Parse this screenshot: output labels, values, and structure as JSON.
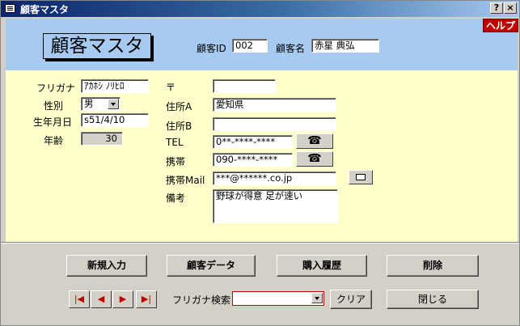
{
  "window": {
    "title": "顧客マスタ",
    "help_label": "?",
    "close_label": "×"
  },
  "header": {
    "help_button": "ヘルプ",
    "form_title": "顧客マスタ",
    "customer_id_label": "顧客ID",
    "customer_id_value": "002",
    "customer_name_label": "顧客名",
    "customer_name_value": "赤星 典弘"
  },
  "form": {
    "furigana_label": "フリガナ",
    "furigana_value": "ｱｶﾎｼ ﾉﾘﾋﾛ",
    "gender_label": "性別",
    "gender_value": "男",
    "birthdate_label": "生年月日",
    "birthdate_value": "s51/4/10",
    "age_label": "年齢",
    "age_value": "30",
    "postal_label": "〒",
    "postal_value": "",
    "address_a_label": "住所A",
    "address_a_value": "愛知県",
    "address_b_label": "住所B",
    "address_b_value": "",
    "tel_label": "TEL",
    "tel_value": "0**-****-****",
    "mobile_label": "携帯",
    "mobile_value": "090-****-****",
    "mobile_mail_label": "携帯Mail",
    "mobile_mail_value": "***@******.co.jp",
    "notes_label": "備考",
    "notes_value": "野球が得意 足が速い"
  },
  "buttons": {
    "new_entry": "新規入力",
    "customer_data": "顧客データ",
    "purchase_history": "購入履歴",
    "delete": "削除",
    "furigana_search_label": "フリガナ検索",
    "clear": "クリア",
    "close": "閉じる"
  },
  "icons": {
    "phone": "☎",
    "nav_first": "|◀",
    "nav_prev": "◀",
    "nav_next": "▶",
    "nav_last": "▶|"
  },
  "colors": {
    "header_bg": "#a6caf0",
    "form_bg": "#ffffcc",
    "help_bg": "#c00000"
  }
}
